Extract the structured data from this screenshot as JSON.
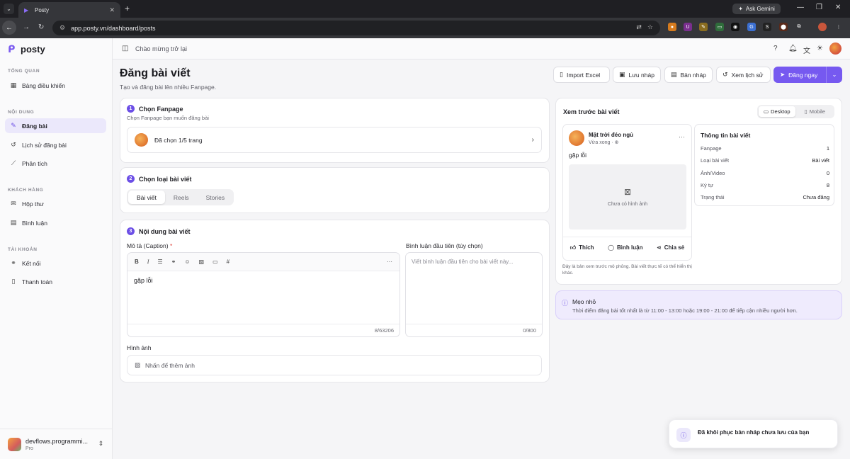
{
  "browser": {
    "tab_title": "Posty",
    "url": "app.posty.vn/dashboard/posts",
    "ask_gemini": "Ask Gemini"
  },
  "sidebar": {
    "brand": "posty",
    "sections": [
      {
        "heading": "TỔNG QUAN",
        "items": [
          {
            "label": "Bảng điều khiển"
          }
        ]
      },
      {
        "heading": "NỘI DUNG",
        "items": [
          {
            "label": "Đăng bài"
          },
          {
            "label": "Lịch sử đăng bài"
          },
          {
            "label": "Phân tích"
          }
        ]
      },
      {
        "heading": "KHÁCH HÀNG",
        "items": [
          {
            "label": "Hộp thư"
          },
          {
            "label": "Bình luận"
          }
        ]
      },
      {
        "heading": "TÀI KHOẢN",
        "items": [
          {
            "label": "Kết nối"
          },
          {
            "label": "Thanh toán"
          }
        ]
      }
    ],
    "user": {
      "name": "devflows.programmi...",
      "plan": "Pro"
    }
  },
  "topbar": {
    "welcome": "Chào mừng trở lại"
  },
  "page": {
    "title": "Đăng bài viết",
    "subtitle": "Tạo và đăng bài lên nhiều Fanpage.",
    "actions": {
      "import": "Import Excel",
      "save_draft": "Lưu nháp",
      "drafts": "Bản nháp",
      "history": "Xem lịch sử",
      "publish": "Đăng ngay"
    }
  },
  "step1": {
    "num": "1",
    "title": "Chọn Fanpage",
    "subtitle": "Chọn Fanpage bạn muốn đăng bài",
    "selected": "Đã chọn 1/5 trang"
  },
  "step2": {
    "num": "2",
    "title": "Chọn loại bài viết",
    "types": [
      "Bài viết",
      "Reels",
      "Stories"
    ]
  },
  "step3": {
    "num": "3",
    "title": "Nội dung bài viết",
    "caption_label": "Mô tả (Caption)",
    "required": "*",
    "caption_value": "gặp lỗi",
    "caption_count": "8/63206",
    "comment_label": "Bình luận đầu tiên (tùy chọn)",
    "comment_placeholder": "Viết bình luận đầu tiên cho bài viết này...",
    "comment_count": "0/800",
    "image_label": "Hình ảnh",
    "image_hint": "Nhấn để thêm ảnh"
  },
  "preview": {
    "title": "Xem trước bài viết",
    "modes": [
      "Desktop",
      "Mobile"
    ],
    "page_name": "Mặt trời đéo ngủ",
    "time": "Vừa xong · ⊕",
    "text": "gặp lỗi",
    "no_image": "Chưa có hình ảnh",
    "like": "Thích",
    "comment": "Bình luận",
    "share": "Chia sẻ",
    "note": "Đây là bản xem trước mô phỏng. Bài viết thực tế có thể hiển thị khác."
  },
  "info": {
    "title": "Thông tin bài viết",
    "rows": [
      {
        "k": "Fanpage",
        "v": "1"
      },
      {
        "k": "Loại bài viết",
        "v": "Bài viết"
      },
      {
        "k": "Ảnh/Video",
        "v": "0"
      },
      {
        "k": "Ký tự",
        "v": "8"
      },
      {
        "k": "Trạng thái",
        "v": "Chưa đăng"
      }
    ]
  },
  "tip": {
    "title": "Mẹo nhỏ",
    "text": "Thời điểm đăng bài tốt nhất là từ 11:00 - 13:00 hoặc 19:00 - 21:00 để tiếp cận nhiều người hơn."
  },
  "toast": {
    "text": "Đã khôi phục bản nháp chưa lưu của bạn"
  },
  "colors": {
    "accent": "#7659f0",
    "tip_bg": "#efebfd"
  }
}
